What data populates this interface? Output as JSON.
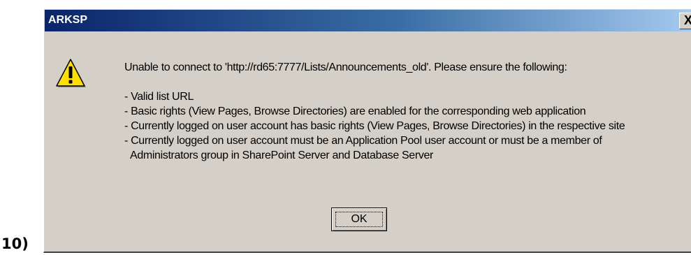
{
  "step_label": "10)",
  "dialog": {
    "title": "ARKSP",
    "close_glyph": "X",
    "icon": "warning-icon",
    "message": {
      "intro": "Unable to connect to 'http://rd65:7777/Lists/Announcements_old'. Please ensure the following:",
      "bullets": [
        "- Valid list URL",
        "- Basic rights (View Pages, Browse Directories) are enabled for the corresponding web application",
        "- Currently logged on user account has basic rights (View Pages, Browse Directories) in the respective site",
        "- Currently logged on user account must be an Application Pool user account or must be a member of"
      ],
      "continuation": "Administrators group in SharePoint Server and Database Server"
    },
    "ok_label": "OK"
  },
  "colors": {
    "dialog_bg": "#d4d0c8",
    "title_start": "#0a246a",
    "title_end": "#a6caf0",
    "warning_yellow": "#ffde00"
  }
}
